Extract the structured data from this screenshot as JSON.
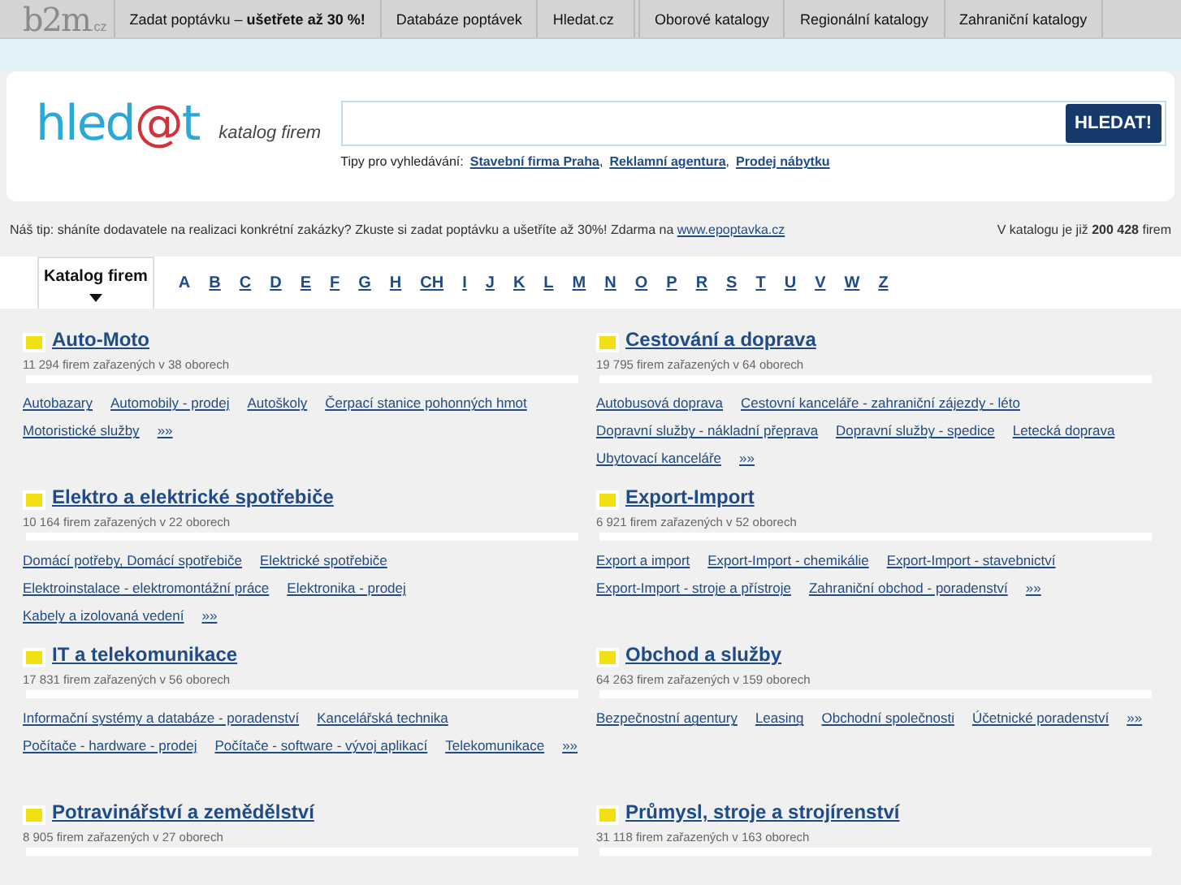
{
  "topnav": {
    "logo": "b2m",
    "logo_suffix": ".cz",
    "items": [
      {
        "label": "Zadat poptávku – **ušetřete až 30 %!**",
        "divider_before": false
      },
      {
        "label": "Databáze poptávek",
        "divider_before": false
      },
      {
        "label": "Hledat.cz",
        "divider_before": false
      },
      {
        "label": "Oborové katalogy",
        "divider_before": true
      },
      {
        "label": "Regionální katalogy",
        "divider_before": false
      },
      {
        "label": "Zahraniční katalogy",
        "divider_before": false
      }
    ]
  },
  "search": {
    "logo_left": "hled",
    "logo_at": "@",
    "logo_right": "t",
    "tagline": "katalog firem",
    "button": "HLEDAT!",
    "tips_label": "Tipy pro vyhledávání:",
    "tips": [
      "Stavební firma Praha",
      "Reklamní agentura",
      "Prodej nábytku"
    ],
    "tips_separator": ","
  },
  "tip_line": {
    "text": "Náš tip: sháníte dodavatele na realizaci konkrétní zakázky? Zkuste si zadat poptávku a ušetříte až 30%! Zdarma na",
    "link": "www.epoptavka.cz"
  },
  "catalog_count": "V katalogu je již **200 428** firem",
  "letters": [
    {
      "label": "Katalog firem",
      "selected": true,
      "link": false
    },
    {
      "label": "A",
      "selected": false,
      "link": false
    },
    {
      "label": "B",
      "selected": false,
      "link": true
    },
    {
      "label": "C",
      "selected": false,
      "link": true
    },
    {
      "label": "D",
      "selected": false,
      "link": true
    },
    {
      "label": "E",
      "selected": false,
      "link": true
    },
    {
      "label": "F",
      "selected": false,
      "link": true
    },
    {
      "label": "G",
      "selected": false,
      "link": true
    },
    {
      "label": "H",
      "selected": false,
      "link": true
    },
    {
      "label": "CH",
      "selected": false,
      "link": true
    },
    {
      "label": "I",
      "selected": false,
      "link": true
    },
    {
      "label": "J",
      "selected": false,
      "link": true
    },
    {
      "label": "K",
      "selected": false,
      "link": true
    },
    {
      "label": "L",
      "selected": false,
      "link": true
    },
    {
      "label": "M",
      "selected": false,
      "link": true
    },
    {
      "label": "N",
      "selected": false,
      "link": true
    },
    {
      "label": "O",
      "selected": false,
      "link": true
    },
    {
      "label": "P",
      "selected": false,
      "link": true
    },
    {
      "label": "R",
      "selected": false,
      "link": true
    },
    {
      "label": "S",
      "selected": false,
      "link": true
    },
    {
      "label": "T",
      "selected": false,
      "link": true
    },
    {
      "label": "U",
      "selected": false,
      "link": true
    },
    {
      "label": "V",
      "selected": false,
      "link": true
    },
    {
      "label": "W",
      "selected": false,
      "link": true
    },
    {
      "label": "Z",
      "selected": false,
      "link": true
    }
  ],
  "categories": [
    {
      "title": "Auto-Moto",
      "count": "11 294 firem zařazených v 38 oborech",
      "links": [
        "Autobazary",
        "Automobily - prodej",
        "Autoškoly",
        "Čerpací stanice pohonných hmot",
        "Motoristické služby",
        "»»"
      ]
    },
    {
      "title": "Cestování a doprava",
      "count": "19 795 firem zařazených v 64 oborech",
      "links": [
        "Autobusová doprava",
        "Cestovní kanceláře - zahraniční zájezdy - léto",
        "Dopravní služby - nákladní přeprava",
        "Dopravní služby - spedice",
        "Letecká doprava",
        "Ubytovací kanceláře",
        "»»"
      ]
    },
    {
      "title": "Elektro a elektrické spotřebiče",
      "count": "10 164 firem zařazených v 22 oborech",
      "links": [
        "Domácí potřeby, Domácí spotřebiče",
        "Elektrické spotřebiče",
        "Elektroinstalace - elektromontážní práce",
        "Elektronika - prodej",
        "Kabely a izolovaná vedení",
        "»»"
      ]
    },
    {
      "title": "Export-Import",
      "count": "6 921 firem zařazených v 52 oborech",
      "links": [
        "Export a import",
        "Export-Import - chemikálie",
        "Export-Import - stavebnictví",
        "Export-Import - stroje a přístroje",
        "Zahraniční obchod - poradenství",
        "»»"
      ]
    },
    {
      "title": "IT a telekomunikace",
      "count": "17 831 firem zařazených v 56 oborech",
      "links": [
        "Informační systémy a databáze - poradenství",
        "Kancelářská technika",
        "Počítače - hardware - prodej",
        "Počítače - software - vývoj aplikací",
        "Telekomunikace",
        "»»"
      ]
    },
    {
      "title": "Obchod a služby",
      "count": "64 263 firem zařazených v 159 oborech",
      "links": [
        "Bezpečnostní agentury",
        "Leasing",
        "Obchodní společnosti",
        "Účetnické poradenství",
        "»»"
      ]
    },
    {
      "title": "Potravinářství a zemědělství",
      "count": "8 905 firem zařazených v 27 oborech"
    },
    {
      "title": "Průmysl, stroje a strojírenství",
      "count": "31 118 firem zařazených v 163 oborech"
    }
  ]
}
